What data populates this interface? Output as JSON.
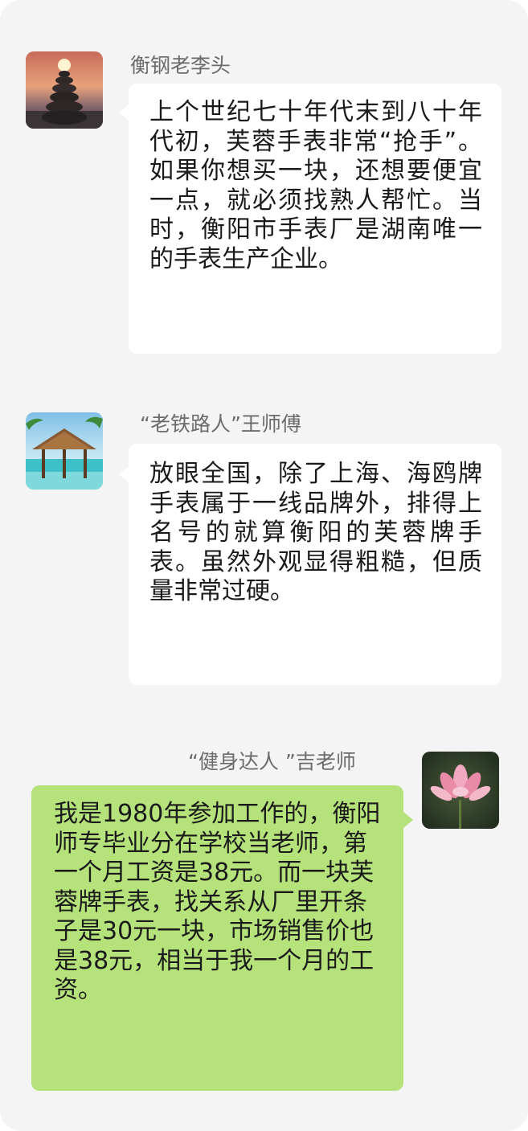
{
  "messages": [
    {
      "sender": "衡钢老李头",
      "avatar_icon": "stacked-stones-sunset-avatar",
      "side": "left",
      "text": "上个世纪七十年代末到八十年代初，芙蓉手表非常“抢手”。如果你想买一块，还想要便宜一点，就必须找熟人帮忙。当时，衡阳市手表厂是湖南唯一的手表生产企业。"
    },
    {
      "sender": "“老铁路人”王师傅",
      "avatar_icon": "beach-hut-avatar",
      "side": "left",
      "text": "放眼全国，除了上海、海鸥牌手表属于一线品牌外，排得上名号的就算衡阳的芙蓉牌手表。虽然外观显得粗糙，但质量非常过硬。"
    },
    {
      "sender": "“健身达人 ”吉老师",
      "avatar_icon": "lotus-flower-avatar",
      "side": "right",
      "text": "我是1980年参加工作的，衡阳师专毕业分在学校当老师，第一个月工资是38元。而一块芙蓉牌手表，找关系从厂里开条子是30元一块，市场销售价也是38元，相当于我一个月的工资。"
    }
  ],
  "colors": {
    "panel_bg": "#f4f4f4",
    "incoming_bubble": "#ffffff",
    "outgoing_bubble": "#b5e27a",
    "sender_name": "#6b6b6b"
  }
}
